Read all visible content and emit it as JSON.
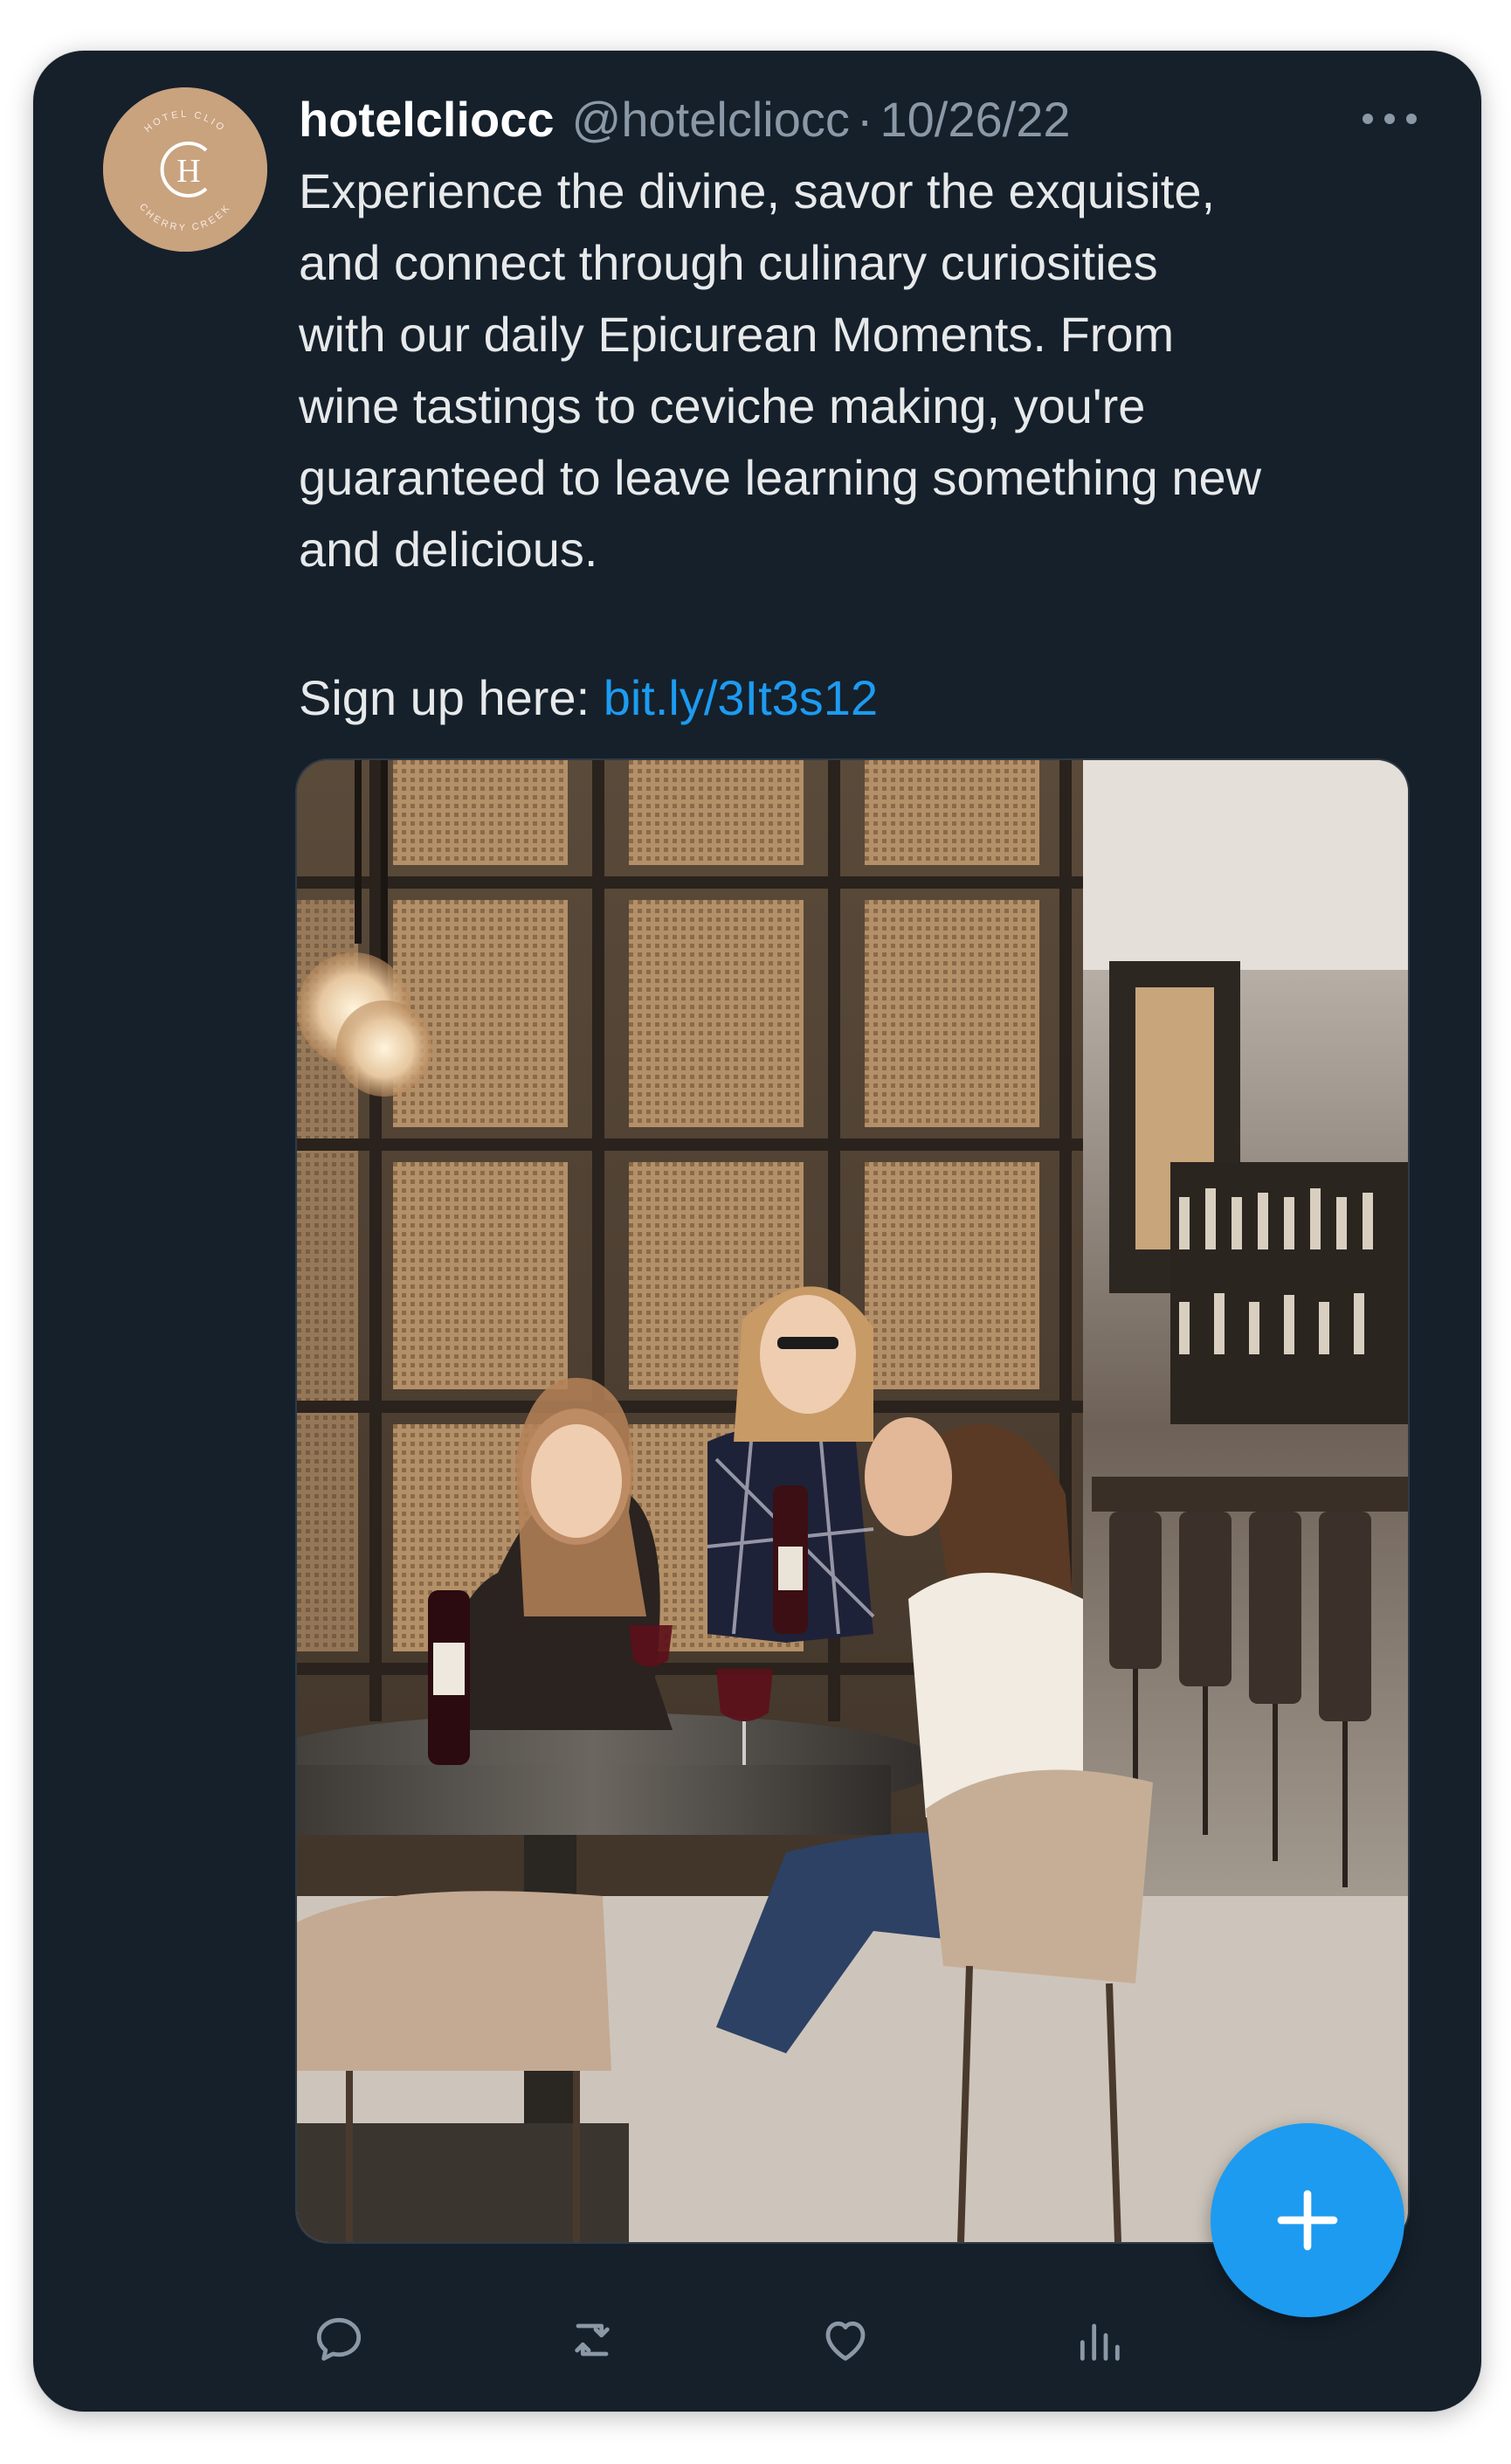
{
  "tweet": {
    "display_name": "hotelcliocc",
    "handle": "@hotelcliocc",
    "separator": "·",
    "date": "10/26/22",
    "body": "Experience the divine, savor the exquisite,\nand connect through culinary curiosities\nwith our daily Epicurean Moments. From\nwine tastings to ceviche making, you're\nguaranteed to leave learning something new\nand delicious.",
    "signup_prefix": "Sign up here: ",
    "signup_link": "bit.ly/3It3s12"
  },
  "avatar": {
    "logo_letter": "H",
    "ring_text_top": "HOTEL CLIO",
    "ring_text_bottom": "CHERRY CREEK"
  },
  "media": {
    "description_icon": "photo-image"
  },
  "actions": {
    "icons": [
      "reply-icon",
      "retweet-icon",
      "like-icon",
      "analytics-icon"
    ]
  },
  "fab": {
    "icon": "plus-icon"
  },
  "colors": {
    "card_bg": "#15202b",
    "link": "#1d9bf0",
    "secondary_text": "#8b98a5",
    "primary_text": "#e7e9ea",
    "avatar_bg": "#c9a27e"
  }
}
